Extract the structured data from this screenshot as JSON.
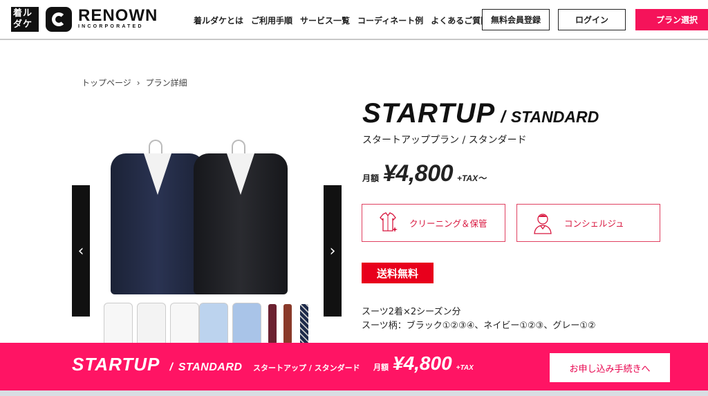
{
  "header": {
    "logo_text": "着ルダケ",
    "brand_name": "RENOWN",
    "brand_sub": "INCORPORATED",
    "nav": [
      "着ルダケとは",
      "ご利用手順",
      "サービス一覧",
      "コーディネート例",
      "よくあるご質問"
    ],
    "register_label": "無料会員登録",
    "login_label": "ログイン",
    "plan_select_label": "プラン選択"
  },
  "breadcrumb": {
    "home": "トップページ",
    "current": "プラン詳細"
  },
  "carousel": {
    "prev_icon": "chevron-left-icon",
    "next_icon": "chevron-right-icon"
  },
  "product": {
    "title_main": "STARTUP",
    "title_sep": "/",
    "title_sub": "STANDARD",
    "subtitle": "スタートアッププラン / スタンダード",
    "price_label": "月額",
    "price": "¥4,800",
    "price_tax": "+TAX〜",
    "features": [
      {
        "label": "クリーニング＆保管",
        "icon": "shirt-sparkle-icon"
      },
      {
        "label": "コンシェルジュ",
        "icon": "concierge-icon"
      }
    ],
    "badge": "送料無料",
    "desc_line1": "スーツ2着×2シーズン分",
    "desc_line2": "スーツ柄：ブラック①②③④、ネイビー①②③、グレー①②"
  },
  "bottom_bar": {
    "title_main": "STARTUP",
    "title_sep": "/",
    "title_sub": "STANDARD",
    "kana": "スタートアップ / スタンダード",
    "price_label": "月額",
    "price": "¥4,800",
    "price_tax": "+TAX",
    "apply_label": "お申し込み手続きへ"
  },
  "colors": {
    "accent": "#ff1464",
    "badge": "#e8001c",
    "feature_border": "#e04060"
  }
}
